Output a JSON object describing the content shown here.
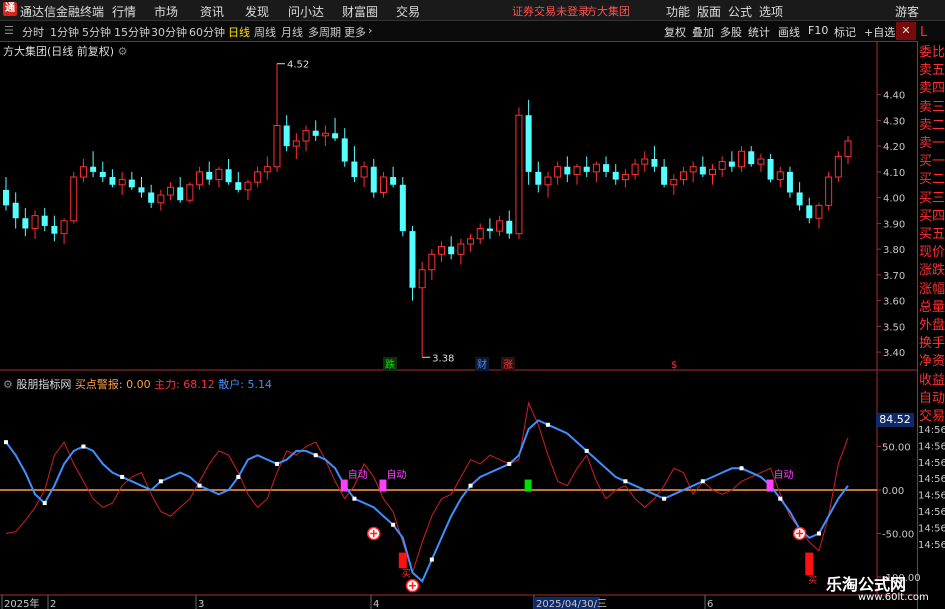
{
  "app": {
    "title": "通达信金融终端",
    "logo": "通"
  },
  "menu": [
    "行情",
    "市场",
    "资讯",
    "发现",
    "问小达",
    "财富圈",
    "交易"
  ],
  "status_text": "证券交易未登录",
  "company": "方大集团",
  "right_menu": [
    "功能",
    "版面",
    "公式",
    "选项"
  ],
  "guest": "游客",
  "periods": [
    {
      "label": "分时"
    },
    {
      "label": "1分钟"
    },
    {
      "label": "5分钟"
    },
    {
      "label": "15分钟"
    },
    {
      "label": "30分钟"
    },
    {
      "label": "60分钟"
    },
    {
      "label": "日线"
    },
    {
      "label": "周线"
    },
    {
      "label": "月线"
    },
    {
      "label": "多周期"
    },
    {
      "label": "更多"
    }
  ],
  "active_period": "日线",
  "tools": [
    "复权",
    "叠加",
    "多股",
    "统计",
    "画线",
    "F10",
    "标记",
    "+自选"
  ],
  "chart_title": "方大集团(日线 前复权)",
  "right_panel": [
    "委比",
    "卖五",
    "卖四",
    "卖三",
    "卖二",
    "卖一",
    "买一",
    "买二",
    "买三",
    "买四",
    "买五",
    "现价",
    "涨跌",
    "涨幅",
    "总量",
    "外盘",
    "换手",
    "净资",
    "收益",
    "自动",
    "交易"
  ],
  "right_panel_top": "L",
  "indicator": {
    "name": "股朋指标网",
    "buy_alert_label": "买点警报: 0.00",
    "main_label": "主力: 68.12",
    "retail_label": "散户: 5.14",
    "value_box": "84.52",
    "right_ticks": [
      "14:56",
      "14:56",
      "14:56",
      "14:56",
      "14:56",
      "14:56",
      "14:56",
      "14:56"
    ]
  },
  "markers": {
    "die": "跌",
    "cai": "财",
    "zhang": "涨",
    "dollar": "$",
    "auto": "自动",
    "buy": "买"
  },
  "date_axis": {
    "labels": [
      "2025年",
      "2",
      "3",
      "4",
      "2025/04/30/三",
      "6"
    ]
  },
  "watermark": {
    "main": "乐淘公式网",
    "url": "www.60lt.com"
  },
  "colors": {
    "up": "#ff3030",
    "down": "#54ffff",
    "bg": "#000000",
    "axis": "#a03030",
    "retail_line": "#3f8fff",
    "zero_line": "#ffa040",
    "magenta": "#ff40ff",
    "green": "#00e000"
  },
  "chart_data": [
    {
      "type": "candlestick",
      "title": "方大集团(日线 前复权)",
      "ylim": [
        3.35,
        4.55
      ],
      "yticks": [
        3.4,
        3.5,
        3.6,
        3.7,
        3.8,
        3.9,
        4.0,
        4.1,
        4.2,
        4.3,
        4.4
      ],
      "annotations": [
        {
          "label": "4.52",
          "value": 4.52
        },
        {
          "label": "3.38",
          "value": 3.38
        }
      ],
      "ohlc": [
        [
          4.03,
          4.08,
          3.95,
          3.97
        ],
        [
          3.98,
          4.02,
          3.88,
          3.92
        ],
        [
          3.92,
          3.96,
          3.85,
          3.88
        ],
        [
          3.88,
          3.95,
          3.84,
          3.93
        ],
        [
          3.93,
          3.96,
          3.87,
          3.89
        ],
        [
          3.89,
          3.93,
          3.83,
          3.86
        ],
        [
          3.86,
          3.92,
          3.82,
          3.91
        ],
        [
          3.91,
          4.1,
          3.9,
          4.08
        ],
        [
          4.08,
          4.15,
          4.06,
          4.12
        ],
        [
          4.12,
          4.18,
          4.08,
          4.1
        ],
        [
          4.1,
          4.14,
          4.06,
          4.08
        ],
        [
          4.08,
          4.11,
          4.04,
          4.05
        ],
        [
          4.05,
          4.1,
          4.01,
          4.07
        ],
        [
          4.07,
          4.1,
          4.03,
          4.04
        ],
        [
          4.04,
          4.08,
          4.0,
          4.02
        ],
        [
          4.02,
          4.05,
          3.96,
          3.98
        ],
        [
          3.98,
          4.03,
          3.95,
          4.01
        ],
        [
          4.01,
          4.06,
          3.99,
          4.04
        ],
        [
          4.04,
          4.08,
          3.98,
          3.99
        ],
        [
          3.99,
          4.06,
          3.98,
          4.05
        ],
        [
          4.05,
          4.12,
          4.03,
          4.1
        ],
        [
          4.1,
          4.14,
          4.05,
          4.07
        ],
        [
          4.07,
          4.12,
          4.04,
          4.11
        ],
        [
          4.11,
          4.15,
          4.05,
          4.06
        ],
        [
          4.06,
          4.1,
          4.02,
          4.03
        ],
        [
          4.03,
          4.07,
          3.99,
          4.06
        ],
        [
          4.06,
          4.12,
          4.04,
          4.1
        ],
        [
          4.1,
          4.16,
          4.07,
          4.12
        ],
        [
          4.12,
          4.52,
          4.1,
          4.28
        ],
        [
          4.28,
          4.32,
          4.18,
          4.2
        ],
        [
          4.2,
          4.25,
          4.15,
          4.22
        ],
        [
          4.22,
          4.28,
          4.18,
          4.26
        ],
        [
          4.26,
          4.3,
          4.22,
          4.24
        ],
        [
          4.24,
          4.28,
          4.2,
          4.25
        ],
        [
          4.25,
          4.31,
          4.22,
          4.23
        ],
        [
          4.23,
          4.27,
          4.12,
          4.14
        ],
        [
          4.14,
          4.2,
          4.06,
          4.08
        ],
        [
          4.08,
          4.14,
          4.04,
          4.12
        ],
        [
          4.12,
          4.15,
          4.0,
          4.02
        ],
        [
          4.02,
          4.1,
          4.0,
          4.08
        ],
        [
          4.08,
          4.12,
          4.04,
          4.05
        ],
        [
          4.05,
          4.08,
          3.85,
          3.87
        ],
        [
          3.87,
          3.89,
          3.6,
          3.65
        ],
        [
          3.65,
          3.75,
          3.38,
          3.72
        ],
        [
          3.72,
          3.8,
          3.68,
          3.78
        ],
        [
          3.78,
          3.83,
          3.75,
          3.81
        ],
        [
          3.81,
          3.85,
          3.76,
          3.78
        ],
        [
          3.78,
          3.84,
          3.74,
          3.82
        ],
        [
          3.82,
          3.86,
          3.79,
          3.84
        ],
        [
          3.84,
          3.9,
          3.82,
          3.88
        ],
        [
          3.88,
          3.92,
          3.84,
          3.87
        ],
        [
          3.87,
          3.93,
          3.85,
          3.91
        ],
        [
          3.91,
          3.95,
          3.84,
          3.86
        ],
        [
          3.86,
          4.35,
          3.84,
          4.32
        ],
        [
          4.32,
          4.38,
          4.05,
          4.1
        ],
        [
          4.1,
          4.14,
          4.02,
          4.05
        ],
        [
          4.05,
          4.1,
          4.0,
          4.08
        ],
        [
          4.08,
          4.14,
          4.05,
          4.12
        ],
        [
          4.12,
          4.16,
          4.06,
          4.09
        ],
        [
          4.09,
          4.13,
          4.05,
          4.12
        ],
        [
          4.12,
          4.16,
          4.08,
          4.1
        ],
        [
          4.1,
          4.14,
          4.06,
          4.13
        ],
        [
          4.13,
          4.16,
          4.08,
          4.1
        ],
        [
          4.1,
          4.13,
          4.05,
          4.07
        ],
        [
          4.07,
          4.11,
          4.04,
          4.09
        ],
        [
          4.09,
          4.15,
          4.07,
          4.13
        ],
        [
          4.13,
          4.18,
          4.1,
          4.15
        ],
        [
          4.15,
          4.2,
          4.1,
          4.12
        ],
        [
          4.12,
          4.15,
          4.04,
          4.05
        ],
        [
          4.05,
          4.09,
          4.01,
          4.07
        ],
        [
          4.07,
          4.12,
          4.05,
          4.1
        ],
        [
          4.1,
          4.14,
          4.06,
          4.12
        ],
        [
          4.12,
          4.16,
          4.08,
          4.09
        ],
        [
          4.09,
          4.13,
          4.05,
          4.11
        ],
        [
          4.11,
          4.16,
          4.08,
          4.14
        ],
        [
          4.14,
          4.18,
          4.1,
          4.12
        ],
        [
          4.12,
          4.2,
          4.1,
          4.18
        ],
        [
          4.18,
          4.2,
          4.12,
          4.13
        ],
        [
          4.13,
          4.17,
          4.1,
          4.15
        ],
        [
          4.15,
          4.17,
          4.06,
          4.07
        ],
        [
          4.07,
          4.12,
          4.04,
          4.1
        ],
        [
          4.1,
          4.12,
          4.0,
          4.02
        ],
        [
          4.02,
          4.06,
          3.95,
          3.97
        ],
        [
          3.97,
          4.0,
          3.9,
          3.92
        ],
        [
          3.92,
          3.98,
          3.88,
          3.97
        ],
        [
          3.97,
          4.1,
          3.95,
          4.08
        ],
        [
          4.08,
          4.18,
          4.06,
          4.16
        ],
        [
          4.16,
          4.24,
          4.13,
          4.22
        ]
      ]
    },
    {
      "type": "line",
      "title": "股朋指标网",
      "ylim": [
        -115,
        115
      ],
      "yticks": [
        50,
        0,
        -50,
        -100
      ],
      "series": [
        {
          "name": "主力",
          "values": [
            -50,
            -48,
            -35,
            -20,
            0,
            40,
            55,
            30,
            10,
            -10,
            -20,
            -15,
            5,
            15,
            20,
            -5,
            -25,
            -30,
            -20,
            -10,
            10,
            30,
            45,
            40,
            20,
            -5,
            -20,
            -10,
            20,
            45,
            40,
            50,
            55,
            35,
            10,
            -10,
            5,
            30,
            15,
            -10,
            -25,
            -60,
            -95,
            -60,
            -30,
            -10,
            -5,
            15,
            35,
            30,
            40,
            35,
            30,
            35,
            100,
            75,
            40,
            10,
            5,
            25,
            40,
            10,
            -10,
            0,
            5,
            -10,
            -20,
            -10,
            5,
            25,
            20,
            -5,
            10,
            0,
            -5,
            0,
            10,
            15,
            20,
            25,
            -5,
            -30,
            -45,
            -60,
            -70,
            -30,
            30,
            60
          ]
        },
        {
          "name": "散户",
          "values": [
            55,
            40,
            20,
            -5,
            -15,
            5,
            30,
            45,
            50,
            45,
            30,
            20,
            15,
            10,
            5,
            0,
            10,
            15,
            20,
            15,
            5,
            0,
            -5,
            0,
            15,
            35,
            40,
            35,
            30,
            35,
            45,
            45,
            40,
            35,
            25,
            5,
            -10,
            -15,
            -20,
            -30,
            -40,
            -55,
            -95,
            -105,
            -80,
            -55,
            -30,
            -10,
            5,
            15,
            20,
            25,
            30,
            40,
            70,
            80,
            75,
            70,
            65,
            55,
            45,
            35,
            25,
            15,
            10,
            5,
            0,
            -5,
            -10,
            -5,
            0,
            5,
            10,
            15,
            20,
            25,
            25,
            20,
            15,
            5,
            -10,
            -25,
            -45,
            -55,
            -50,
            -30,
            -10,
            5
          ]
        }
      ],
      "markers": [
        {
          "label": "自动",
          "index": 35
        },
        {
          "label": "自动",
          "index": 39
        },
        {
          "label": "自动",
          "index": 79
        }
      ]
    }
  ]
}
